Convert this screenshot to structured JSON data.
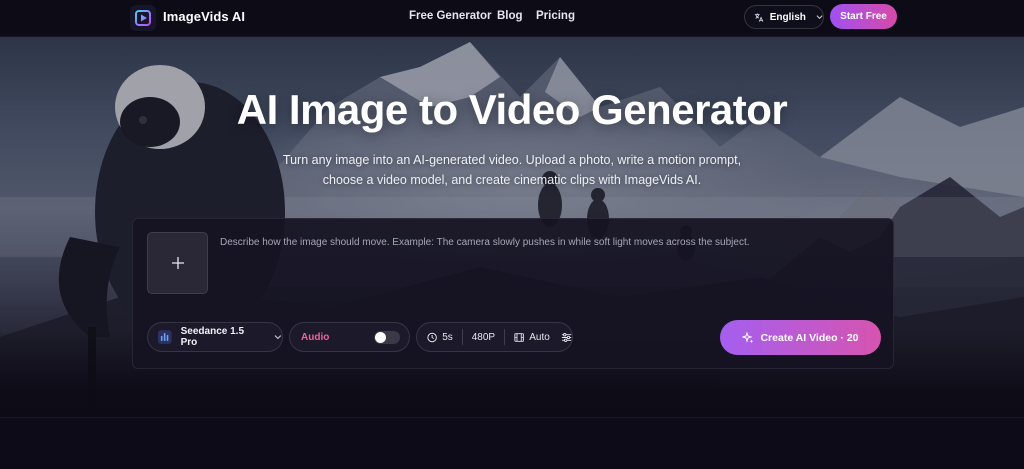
{
  "nav": {
    "brand": "ImageVids AI",
    "links": [
      "Free Generator",
      "Blog",
      "Pricing"
    ],
    "language": "English",
    "cta": "Start Free"
  },
  "hero": {
    "title": "AI Image to Video Generator",
    "subtitle": "Turn any image into an AI-generated video. Upload a photo, write a motion prompt, choose a video model, and create cinematic clips with ImageVids AI."
  },
  "generator": {
    "upload_icon": "plus-icon",
    "prompt_placeholder": "Describe how the image should move. Example: The camera slowly pushes in while soft light moves across the subject.",
    "model": "Seedance 1.5 Pro",
    "audio_label": "Audio",
    "audio_enabled": false,
    "duration": "5s",
    "resolution": "480P",
    "aspect": "Auto",
    "create_label": "Create AI Video · 20"
  },
  "colors": {
    "accent_start": "#a051f0",
    "accent_end": "#d64aa8",
    "audio_pink": "#f0639c",
    "page_bg": "#0b0a14"
  }
}
